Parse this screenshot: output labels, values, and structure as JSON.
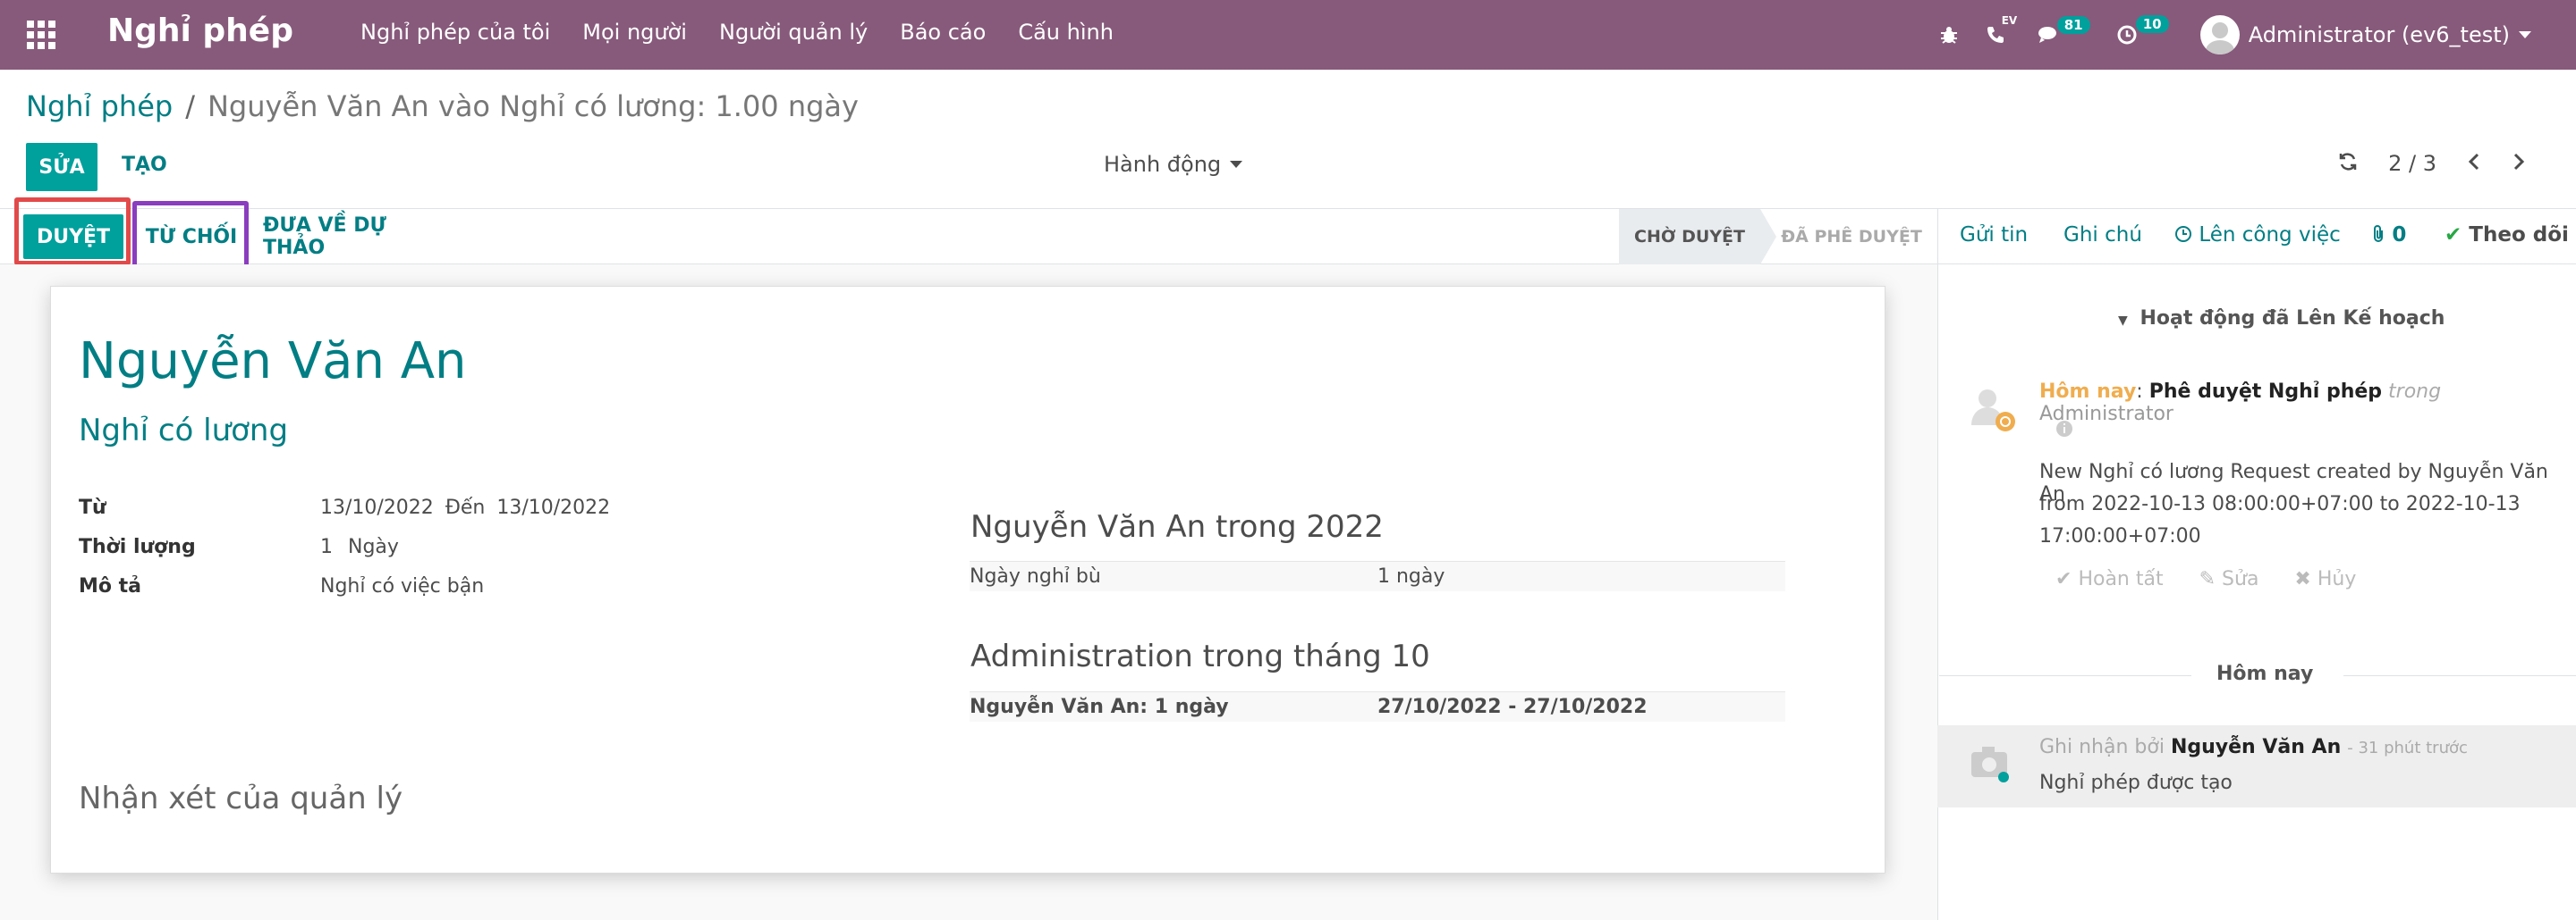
{
  "navbar": {
    "brand": "Nghỉ phép",
    "menu": [
      "Nghỉ phép của tôi",
      "Mọi người",
      "Người quản lý",
      "Báo cáo",
      "Cấu hình"
    ],
    "ev_label": "EV",
    "messages_count": "81",
    "activities_count": "10",
    "user": "Administrator (ev6_test)"
  },
  "breadcrumb": {
    "root": "Nghỉ phép",
    "separator": "/",
    "current": "Nguyễn Văn An vào Nghỉ có lương: 1.00 ngày"
  },
  "toolbar": {
    "edit": "SỬA",
    "create": "TẠO",
    "action": "Hành động",
    "pager": "2 / 3"
  },
  "statusbar": {
    "approve": "DUYỆT",
    "refuse": "TỪ CHỐI",
    "reset": "ĐƯA VỀ DỰ THẢO",
    "stage_current": "CHỜ DUYỆT",
    "stage_next": "ĐÃ PHÊ DUYỆT"
  },
  "form": {
    "employee": "Nguyễn Văn An",
    "leave_type": "Nghỉ có lương",
    "from_label": "Từ",
    "from_date": "13/10/2022",
    "to_label": "Đến",
    "to_date": "13/10/2022",
    "duration_label": "Thời lượng",
    "duration_value": "1",
    "duration_unit": "Ngày",
    "desc_label": "Mô tả",
    "desc_value": "Nghỉ có việc bận",
    "group1_title": "Nguyễn Văn An trong 2022",
    "group1_row_label": "Ngày nghỉ bù",
    "group1_row_value": "1 ngày",
    "group2_title": "Administration trong tháng 10",
    "group2_row_label": "Nguyễn Văn An: 1 ngày",
    "group2_row_value": "27/10/2022 - 27/10/2022",
    "manager_note": "Nhận xét của quản lý"
  },
  "chatter": {
    "send_message": "Gửi tin",
    "log_note": "Ghi chú",
    "schedule_activity": "Lên công việc",
    "attachments": "0",
    "follow": "Theo dõi",
    "planned_title": "Hoạt động đã Lên Kế hoạch",
    "activity_date": "Hôm nay",
    "activity_colon": ":",
    "activity_summary": "Phê duyệt Nghỉ phép",
    "activity_in": "trong",
    "activity_user": "Administrator",
    "activity_note_1": "New Nghỉ có lương Request created by Nguyễn Văn An",
    "activity_note_2": "from 2022-10-13 08:00:00+07:00 to 2022-10-13",
    "activity_note_3": "17:00:00+07:00",
    "done": "Hoàn tất",
    "edit": "Sửa",
    "cancel": "Hủy",
    "today_separator": "Hôm nay",
    "msg_prefix": "Ghi nhận bởi",
    "msg_author": "Nguyễn Văn An",
    "msg_time": "- 31 phút trước",
    "msg_body": "Nghỉ phép được tạo"
  },
  "colors": {
    "navbar": "#875a7b",
    "primary": "#00a09d",
    "link": "#017e84",
    "highlight_red": "#e24a4a",
    "highlight_purple": "#8a3dbf"
  }
}
